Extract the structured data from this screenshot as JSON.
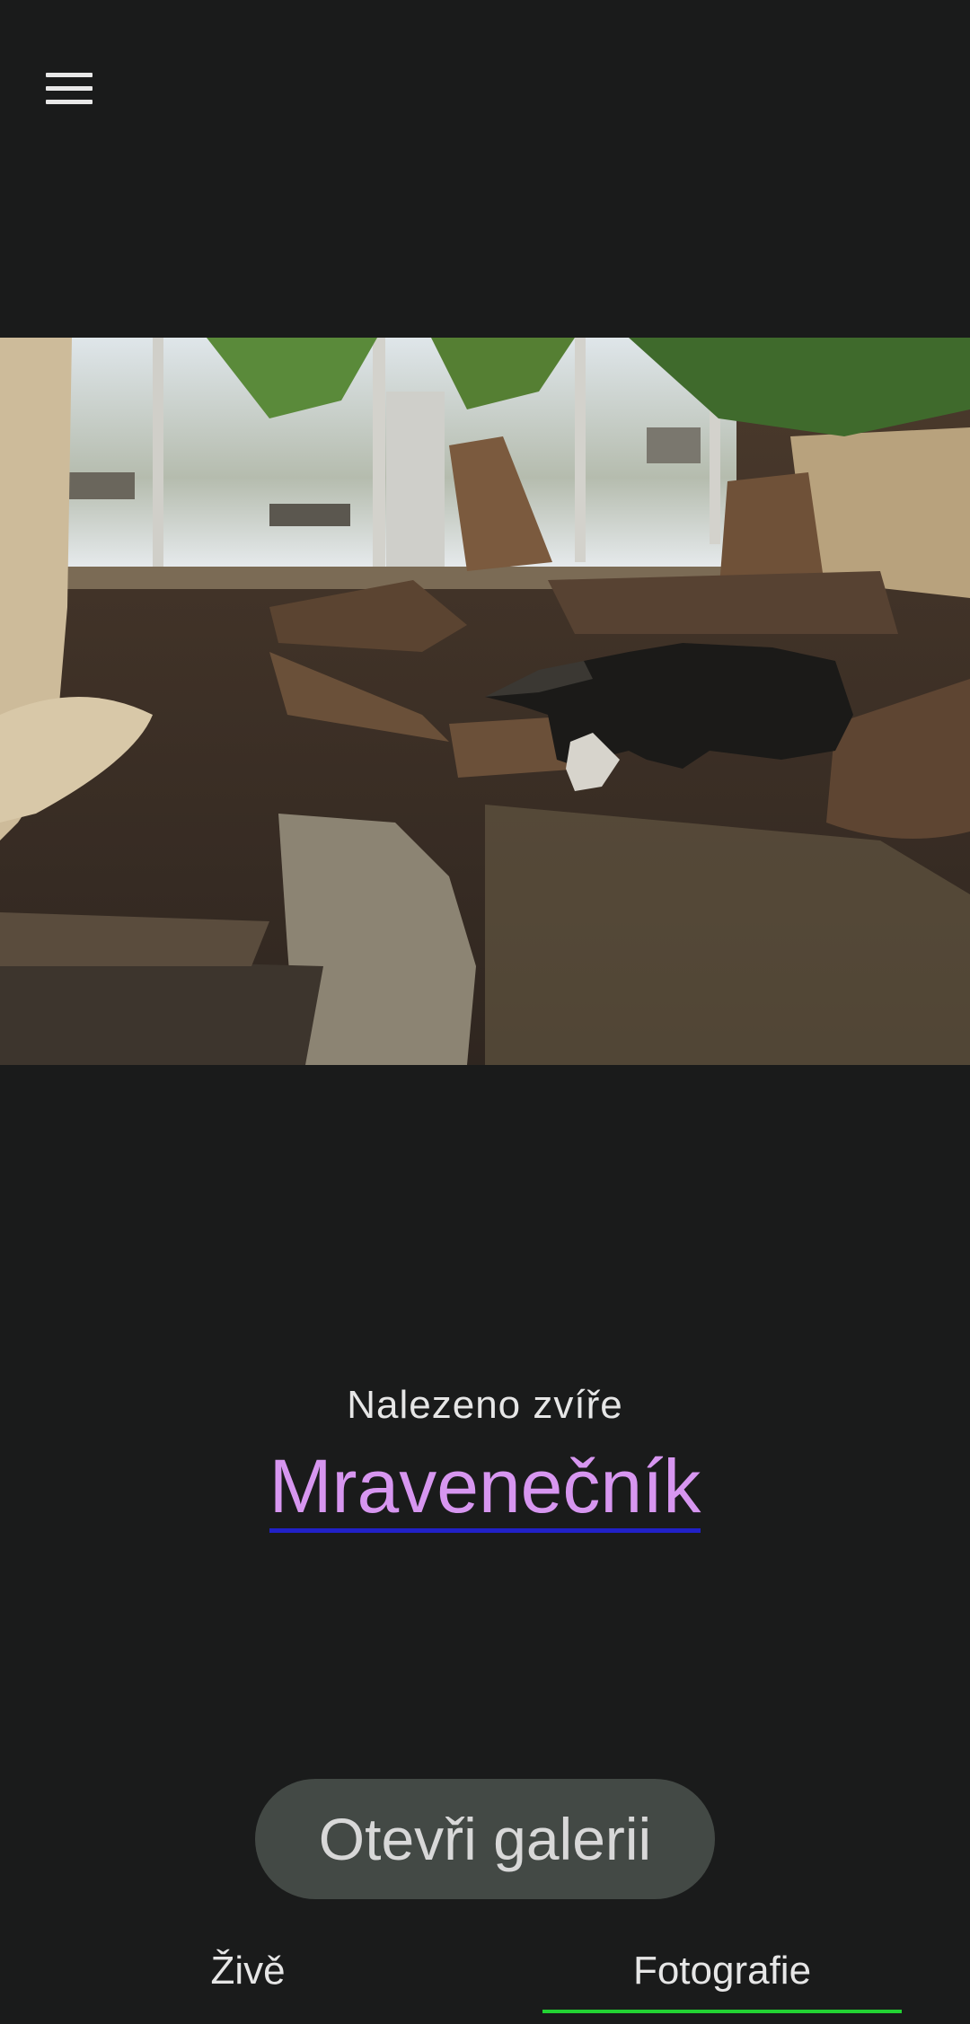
{
  "header": {
    "menu_icon": "hamburger-menu-icon"
  },
  "photo": {
    "subject": "anteater-enclosure-photo"
  },
  "result": {
    "found_label": "Nalezeno zvíře",
    "animal_name": "Mravenečník",
    "link_color": "#d796f0"
  },
  "actions": {
    "open_gallery_label": "Otevři galerii"
  },
  "tabs": {
    "items": [
      {
        "label": "Živě",
        "selected": false
      },
      {
        "label": "Fotografie",
        "selected": true
      }
    ],
    "indicator_color": "#22d233"
  }
}
